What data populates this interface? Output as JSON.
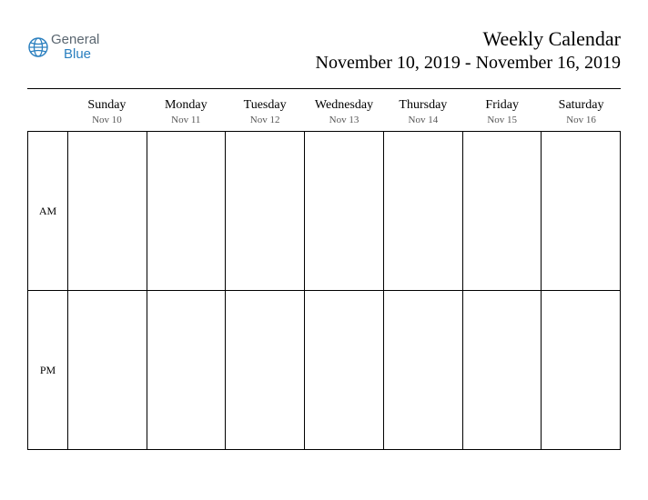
{
  "logo": {
    "line1": "General",
    "line2": "Blue"
  },
  "header": {
    "title": "Weekly Calendar",
    "date_range": "November 10, 2019 - November 16, 2019"
  },
  "days": [
    {
      "name": "Sunday",
      "date": "Nov 10"
    },
    {
      "name": "Monday",
      "date": "Nov 11"
    },
    {
      "name": "Tuesday",
      "date": "Nov 12"
    },
    {
      "name": "Wednesday",
      "date": "Nov 13"
    },
    {
      "name": "Thursday",
      "date": "Nov 14"
    },
    {
      "name": "Friday",
      "date": "Nov 15"
    },
    {
      "name": "Saturday",
      "date": "Nov 16"
    }
  ],
  "periods": [
    {
      "label": "AM"
    },
    {
      "label": "PM"
    }
  ]
}
